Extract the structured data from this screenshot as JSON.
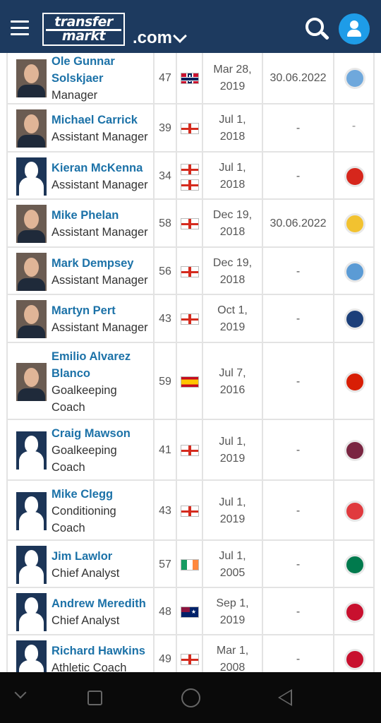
{
  "header": {
    "logo_line1": "transfer",
    "logo_line2": "markt",
    "domain": ".com",
    "menu_icon": "hamburger-menu-icon",
    "search_icon": "search-icon",
    "user_icon": "user-icon",
    "background_color": "#1d3a5f",
    "user_button_color": "#1e9ce8"
  },
  "staff": [
    {
      "name_line1": "Ole Gunnar",
      "name_line2": "Solskjaer",
      "role_line1": "Manager",
      "role_line2": "",
      "age": "47",
      "nationality": [
        "norway"
      ],
      "appointed_line1": "Mar 28,",
      "appointed_line2": "2019",
      "contract": "30.06.2022",
      "club_crest": "molde-crest",
      "photo": "real"
    },
    {
      "name_line1": "Michael Carrick",
      "name_line2": "",
      "role_line1": "Assistant Manager",
      "role_line2": "",
      "age": "39",
      "nationality": [
        "england"
      ],
      "appointed_line1": "Jul 1,",
      "appointed_line2": "2018",
      "contract": "-",
      "club_crest": "-",
      "photo": "real"
    },
    {
      "name_line1": "Kieran McKenna",
      "name_line2": "",
      "role_line1": "Assistant Manager",
      "role_line2": "",
      "age": "34",
      "nationality": [
        "england",
        "england"
      ],
      "appointed_line1": "Jul 1,",
      "appointed_line2": "2018",
      "contract": "-",
      "club_crest": "man-utd-crest",
      "photo": "silhouette"
    },
    {
      "name_line1": "Mike Phelan",
      "name_line2": "",
      "role_line1": "Assistant Manager",
      "role_line2": "",
      "age": "58",
      "nationality": [
        "england"
      ],
      "appointed_line1": "Dec 19,",
      "appointed_line2": "2018",
      "contract": "30.06.2022",
      "club_crest": "central-coast-crest",
      "photo": "real"
    },
    {
      "name_line1": "Mark Dempsey",
      "name_line2": "",
      "role_line1": "Assistant Manager",
      "role_line2": "",
      "age": "56",
      "nationality": [
        "england"
      ],
      "appointed_line1": "Dec 19,",
      "appointed_line2": "2018",
      "contract": "-",
      "club_crest": "macclesfield-crest",
      "photo": "real"
    },
    {
      "name_line1": "Martyn Pert",
      "name_line2": "",
      "role_line1": "Assistant Manager",
      "role_line2": "",
      "age": "43",
      "nationality": [
        "england"
      ],
      "appointed_line1": "Oct 1,",
      "appointed_line2": "2019",
      "contract": "-",
      "club_crest": "vancouver-crest",
      "photo": "real"
    },
    {
      "name_line1": "Emilio Alvarez",
      "name_line2": "Blanco",
      "role_line1": "Goalkeeping",
      "role_line2": "Coach",
      "age": "59",
      "nationality": [
        "spain"
      ],
      "appointed_line1": "Jul 7,",
      "appointed_line2": "2016",
      "contract": "-",
      "club_crest": "benfica-crest",
      "photo": "real"
    },
    {
      "name_line1": "Craig Mawson",
      "name_line2": "",
      "role_line1": "Goalkeeping",
      "role_line2": "Coach",
      "age": "41",
      "nationality": [
        "england"
      ],
      "appointed_line1": "Jul 1,",
      "appointed_line2": "2019",
      "contract": "-",
      "club_crest": "burnley-crest",
      "photo": "silhouette"
    },
    {
      "name_line1": "Mike Clegg",
      "name_line2": "",
      "role_line1": "Conditioning",
      "role_line2": "Coach",
      "age": "43",
      "nationality": [
        "england"
      ],
      "appointed_line1": "Jul 1,",
      "appointed_line2": "2019",
      "contract": "-",
      "club_crest": "sunderland-crest",
      "photo": "silhouette"
    },
    {
      "name_line1": "Jim Lawlor",
      "name_line2": "",
      "role_line1": "Chief Analyst",
      "role_line2": "",
      "age": "57",
      "nationality": [
        "ireland"
      ],
      "appointed_line1": "Jul 1,",
      "appointed_line2": "2005",
      "contract": "-",
      "club_crest": "south-africa-crest",
      "photo": "silhouette"
    },
    {
      "name_line1": "Andrew Meredith",
      "name_line2": "",
      "role_line1": "Chief Analyst",
      "role_line2": "",
      "age": "48",
      "nationality": [
        "australia"
      ],
      "appointed_line1": "Sep 1,",
      "appointed_line2": "2019",
      "contract": "-",
      "club_crest": "st-pauli-crest",
      "photo": "silhouette"
    },
    {
      "name_line1": "Richard Hawkins",
      "name_line2": "",
      "role_line1": "Athletic Coach",
      "role_line2": "",
      "age": "49",
      "nationality": [
        "england"
      ],
      "appointed_line1": "Mar 1,",
      "appointed_line2": "2008",
      "contract": "-",
      "club_crest": "sheffield-utd-crest",
      "photo": "silhouette"
    }
  ],
  "navbar": {
    "icons": [
      "collapse-icon",
      "recent-apps-icon",
      "home-icon",
      "back-icon"
    ]
  }
}
